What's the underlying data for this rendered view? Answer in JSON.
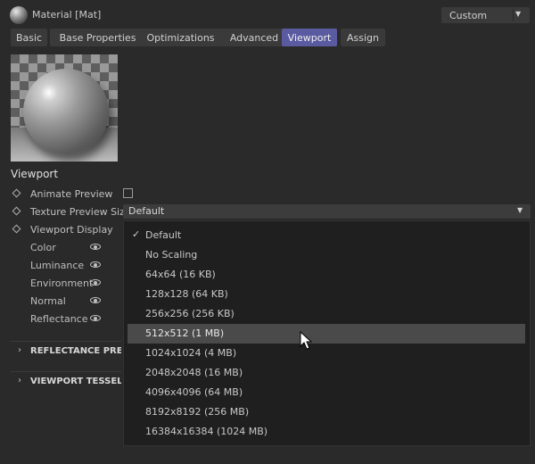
{
  "header": {
    "title": "Material [Mat]",
    "preset": "Custom",
    "material_icon": "material-sphere-icon"
  },
  "tabs": [
    {
      "label": "Basic",
      "active": false
    },
    {
      "label": "Base Properties",
      "active": false
    },
    {
      "label": "Optimizations",
      "active": false
    },
    {
      "label": "Advanced",
      "active": false
    },
    {
      "label": "Viewport",
      "active": true
    },
    {
      "label": "Assign",
      "active": false
    }
  ],
  "colors": {
    "accent": "#5a5aa0",
    "background": "#2a2a2a",
    "dropdown_bg": "#1f1f1f",
    "highlight": "#4a4a4a"
  },
  "section": {
    "title": "Viewport"
  },
  "properties": {
    "animate_preview": {
      "label": "Animate Preview",
      "checked": false
    },
    "texture_preview_size": {
      "label": "Texture Preview Size",
      "value": "Default"
    },
    "viewport_display": {
      "label": "Viewport Display"
    }
  },
  "channels": [
    {
      "label": "Color",
      "icon": "eye-icon"
    },
    {
      "label": "Luminance",
      "icon": "eye-icon"
    },
    {
      "label": "Environment",
      "icon": "eye-icon"
    },
    {
      "label": "Normal",
      "icon": "eye-icon"
    },
    {
      "label": "Reflectance",
      "icon": "eye-icon"
    }
  ],
  "groups": [
    {
      "label": "REFLECTANCE PREVIEW"
    },
    {
      "label": "VIEWPORT TESSELLATION"
    }
  ],
  "dropdown": {
    "selected": "Default",
    "hovered": "512x512 (1 MB)",
    "options": [
      "Default",
      "No Scaling",
      "64x64 (16 KB)",
      "128x128 (64 KB)",
      "256x256 (256 KB)",
      "512x512 (1 MB)",
      "1024x1024 (4 MB)",
      "2048x2048 (16 MB)",
      "4096x4096 (64 MB)",
      "8192x8192 (256 MB)",
      "16384x16384 (1024 MB)"
    ]
  }
}
